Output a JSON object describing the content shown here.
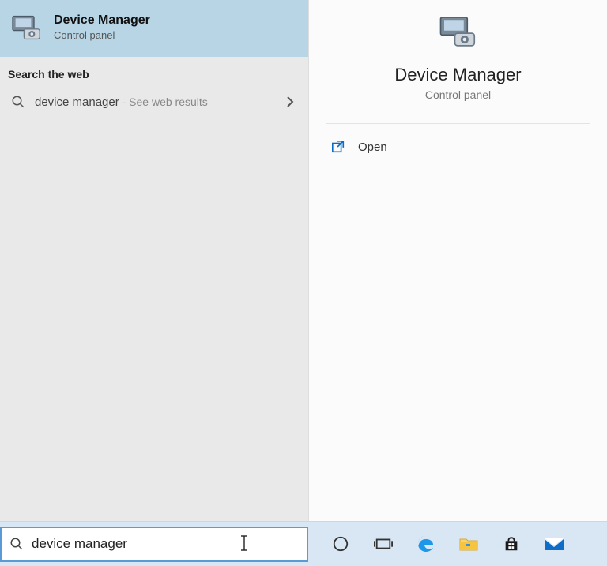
{
  "bestMatch": {
    "title": "Device Manager",
    "subtitle": "Control panel"
  },
  "web": {
    "sectionLabel": "Search the web",
    "query": "device manager",
    "suffix": " - See web results"
  },
  "detail": {
    "title": "Device Manager",
    "subtitle": "Control panel",
    "actions": {
      "open": "Open"
    }
  },
  "search": {
    "value": "device manager"
  }
}
